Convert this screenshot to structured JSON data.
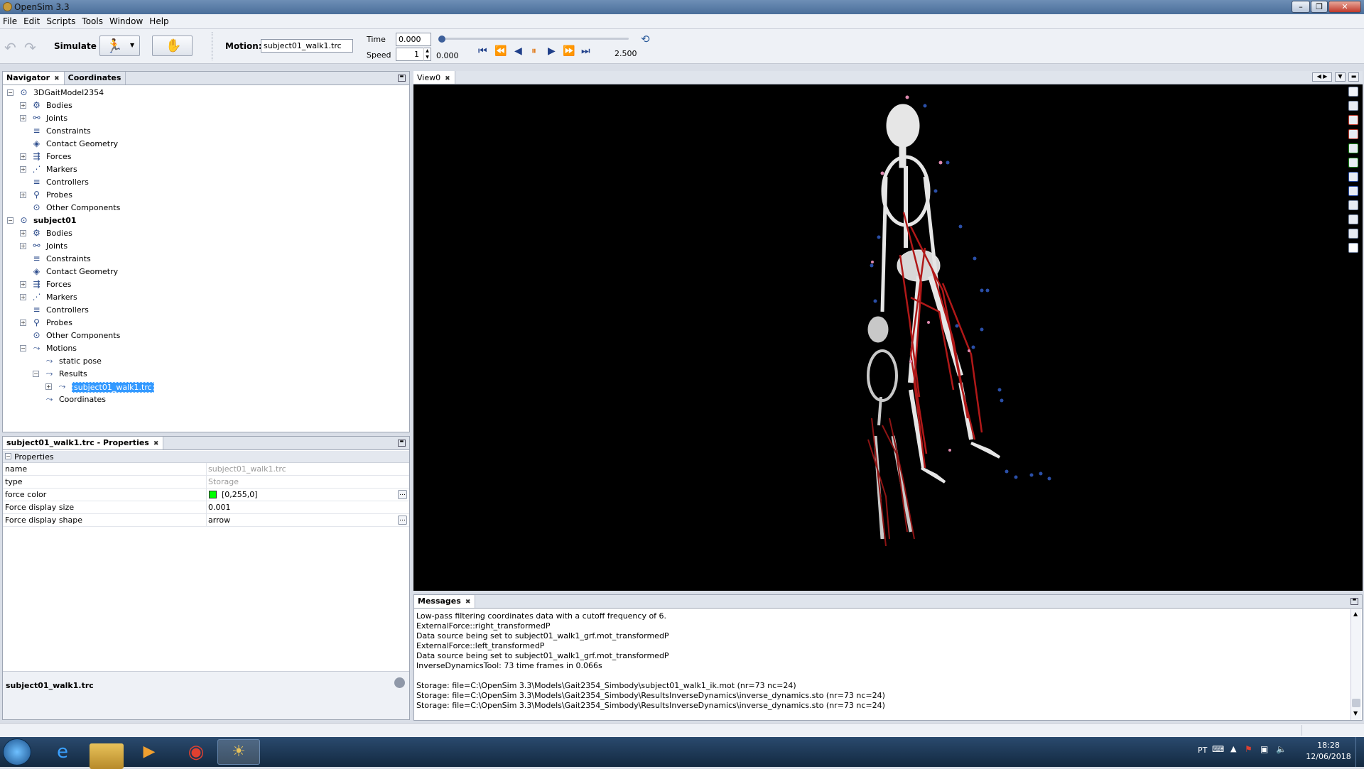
{
  "window": {
    "title": "OpenSim 3.3"
  },
  "menu": [
    "File",
    "Edit",
    "Scripts",
    "Tools",
    "Window",
    "Help"
  ],
  "toolbar": {
    "simulate_label": "Simulate",
    "motion_label": "Motion:",
    "motion_value": "subject01_walk1.trc",
    "time_label": "Time",
    "time_value": "0.000",
    "speed_label": "Speed",
    "speed_value": "1",
    "range_start": "0.000",
    "range_end": "2.500"
  },
  "navigator": {
    "tabs": [
      "Navigator",
      "Coordinates"
    ],
    "model1": {
      "name": "3DGaitModel2354",
      "children": [
        "Bodies",
        "Joints",
        "Constraints",
        "Contact Geometry",
        "Forces",
        "Markers",
        "Controllers",
        "Probes",
        "Other Components"
      ]
    },
    "model2": {
      "name": "subject01",
      "children": [
        "Bodies",
        "Joints",
        "Constraints",
        "Contact Geometry",
        "Forces",
        "Markers",
        "Controllers",
        "Probes",
        "Other Components",
        "Motions"
      ]
    },
    "motions": {
      "static": "static pose",
      "results": "Results",
      "selected": "subject01_walk1.trc",
      "coords": "Coordinates"
    }
  },
  "properties": {
    "tab_title": "subject01_walk1.trc - Properties",
    "section": "Properties",
    "rows": [
      {
        "key": "name",
        "value": "subject01_walk1.trc"
      },
      {
        "key": "type",
        "value": "Storage"
      },
      {
        "key": "force color",
        "value": "[0,255,0]"
      },
      {
        "key": "Force display size",
        "value": "0.001"
      },
      {
        "key": "Force display shape",
        "value": "arrow"
      }
    ],
    "footer_title": "subject01_walk1.trc",
    "force_color_hex": "#00ff00"
  },
  "view": {
    "tab": "View0"
  },
  "messages": {
    "title": "Messages",
    "lines": [
      "Low-pass filtering coordinates data with a cutoff frequency of 6.",
      "ExternalForce::right_transformedP",
      "Data source being set to subject01_walk1_grf.mot_transformedP",
      "ExternalForce::left_transformedP",
      "Data source being set to subject01_walk1_grf.mot_transformedP",
      "InverseDynamicsTool: 73 time frames in 0.066s",
      "",
      "Storage: file=C:\\OpenSim 3.3\\Models\\Gait2354_Simbody\\subject01_walk1_ik.mot (nr=73 nc=24)",
      "Storage: file=C:\\OpenSim 3.3\\Models\\Gait2354_Simbody\\ResultsInverseDynamics\\inverse_dynamics.sto (nr=73 nc=24)",
      "Storage: file=C:\\OpenSim 3.3\\Models\\Gait2354_Simbody\\ResultsInverseDynamics\\inverse_dynamics.sto (nr=73 nc=24)"
    ]
  },
  "taskbar": {
    "lang": "PT",
    "time": "18:28",
    "date": "12/06/2018"
  }
}
